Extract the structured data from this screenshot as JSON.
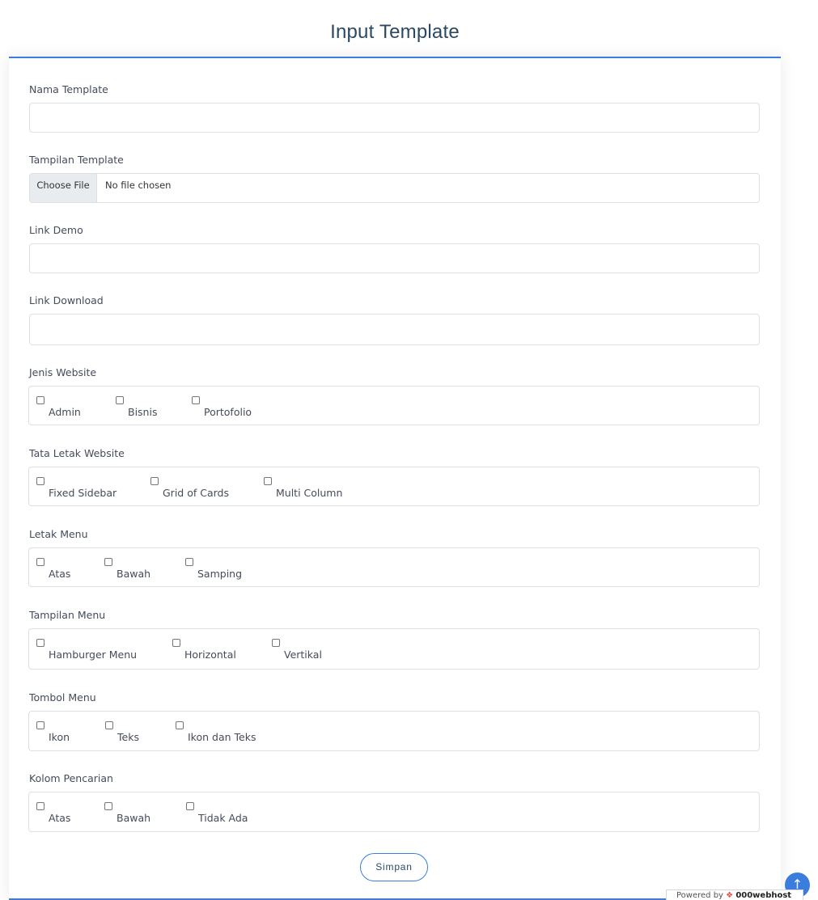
{
  "page": {
    "title": "Input Template"
  },
  "fields": {
    "nama_template": {
      "label": "Nama Template",
      "value": "",
      "placeholder": ""
    },
    "tampilan_template": {
      "label": "Tampilan Template",
      "button_label": "Choose File",
      "status": "No file chosen"
    },
    "link_demo": {
      "label": "Link Demo",
      "value": "",
      "placeholder": ""
    },
    "link_download": {
      "label": "Link Download",
      "value": "",
      "placeholder": ""
    }
  },
  "groups": {
    "jenis_website": {
      "label": "Jenis Website",
      "options": [
        "Admin",
        "Bisnis",
        "Portofolio"
      ]
    },
    "tata_letak": {
      "label": "Tata Letak Website",
      "options": [
        "Fixed Sidebar",
        "Grid of Cards",
        "Multi Column"
      ]
    },
    "letak_menu": {
      "label": "Letak Menu",
      "options": [
        "Atas",
        "Bawah",
        "Samping"
      ]
    },
    "tampilan_menu": {
      "label": "Tampilan Menu",
      "options": [
        "Hamburger Menu",
        "Horizontal",
        "Vertikal"
      ]
    },
    "tombol_menu": {
      "label": "Tombol Menu",
      "options": [
        "Ikon",
        "Teks",
        "Ikon dan Teks"
      ]
    },
    "kolom_pencarian": {
      "label": "Kolom Pencarian",
      "options": [
        "Atas",
        "Bawah",
        "Tidak Ada"
      ]
    }
  },
  "actions": {
    "submit_label": "Simpan"
  },
  "footer": {
    "back_to_top_icon": "arrow-up-icon",
    "powered_prefix": "Powered by",
    "powered_brand": "000webhost"
  },
  "colors": {
    "accent": "#3b7ddd",
    "title": "#2c4964",
    "border": "#dcdfe4"
  }
}
